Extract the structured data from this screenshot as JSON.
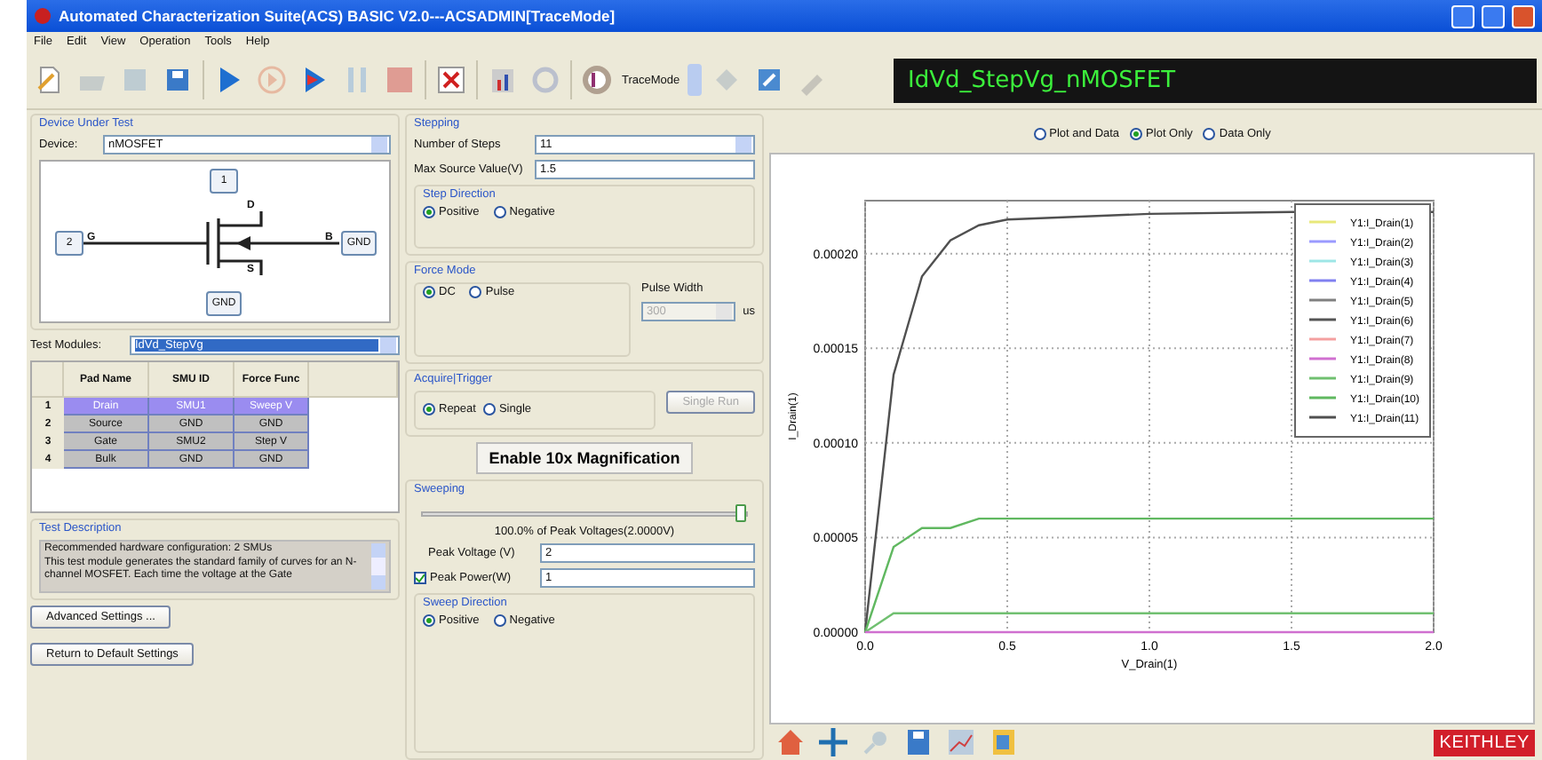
{
  "window": {
    "title": "Automated Characterization Suite(ACS) BASIC V2.0---ACSADMIN[TraceMode]"
  },
  "menu": [
    "File",
    "Edit",
    "View",
    "Operation",
    "Tools",
    "Help"
  ],
  "toolbar": {
    "mode_label": "TraceMode",
    "test_title": "IdVd_StepVg_nMOSFET"
  },
  "device_under_test": {
    "title": "Device Under Test",
    "device_label": "Device:",
    "device_value": "nMOSFET",
    "diagram": {
      "top_pad": "1",
      "left_pad": "2",
      "right_pad": "GND",
      "bottom_pad": "GND",
      "gate": "G",
      "drain": "D",
      "bulk": "B",
      "source": "S"
    }
  },
  "test_modules": {
    "label": "Test Modules:",
    "value": "IdVd_StepVg"
  },
  "pad_table": {
    "columns": [
      "Pad Name",
      "SMU  ID",
      "Force Func"
    ],
    "rows": [
      {
        "index": "1",
        "cells": [
          "Drain",
          "SMU1",
          "Sweep V"
        ],
        "selected": true
      },
      {
        "index": "2",
        "cells": [
          "Source",
          "GND",
          "GND"
        ],
        "selected": false
      },
      {
        "index": "3",
        "cells": [
          "Gate",
          "SMU2",
          "Step V"
        ],
        "selected": false
      },
      {
        "index": "4",
        "cells": [
          "Bulk",
          "GND",
          "GND"
        ],
        "selected": false
      }
    ]
  },
  "test_description": {
    "title": "Test Description",
    "lines": [
      "Recommended hardware configuration: 2 SMUs",
      "This test module generates the standard family of curves for an N-channel MOSFET. Each time the voltage at the Gate"
    ]
  },
  "left_buttons": [
    "Advanced Settings ...",
    "Return to Default Settings"
  ],
  "stepping": {
    "title": "Stepping",
    "steps_label": "Number  of  Steps",
    "steps_value": "11",
    "max_label": "Max Source Value(V)",
    "max_value": "1.5",
    "direction_title": "Step Direction",
    "direction": [
      {
        "label": "Positive",
        "selected": true
      },
      {
        "label": "Negative",
        "selected": false
      }
    ]
  },
  "force_mode": {
    "title": "Force Mode",
    "options": [
      {
        "label": "DC",
        "selected": true
      },
      {
        "label": "Pulse",
        "selected": false
      }
    ],
    "pulse_label": "Pulse Width",
    "pulse_value": "300",
    "pulse_disabled": true,
    "pulse_unit": "us"
  },
  "acquire": {
    "title": "Acquire|Trigger",
    "options": [
      {
        "label": "Repeat",
        "selected": true
      },
      {
        "label": "Single",
        "selected": false
      }
    ],
    "single_run": "Single Run",
    "single_run_disabled": true
  },
  "magnify_button": "Enable 10x Magnification",
  "sweeping": {
    "title": "Sweeping",
    "level": 1,
    "reading": "100.0% of Peak Voltages(2.0000V)",
    "peak_voltage_label": "Peak  Voltage (V)",
    "peak_voltage": "2",
    "peak_power_label": "Peak Power(W)",
    "peak_power_checked": true,
    "peak_power": "1",
    "direction_title": "Sweep Direction",
    "direction": [
      {
        "label": "Positive",
        "selected": true
      },
      {
        "label": "Negative",
        "selected": false
      }
    ]
  },
  "view_options": [
    {
      "label": "Plot and Data",
      "selected": false
    },
    {
      "label": "Plot Only",
      "selected": true
    },
    {
      "label": "Data Only",
      "selected": false
    }
  ],
  "chart": {
    "chart_data": {
      "type": "line",
      "xlabel": "V_Drain(1)",
      "ylabel": "I_Drain(1)",
      "x": [
        0,
        0.1,
        0.2,
        0.3,
        0.4,
        0.5,
        1.0,
        1.5,
        2.0
      ],
      "xlim": [
        0,
        2
      ],
      "ylim": [
        0,
        0.000228
      ],
      "grid": true,
      "legend": true,
      "xticks": [
        {
          "value": 0,
          "label": "0.0"
        },
        {
          "value": 0.5,
          "label": "0.5"
        },
        {
          "value": 1,
          "label": "1.0"
        },
        {
          "value": 1.5,
          "label": "1.5"
        },
        {
          "value": 2,
          "label": "2.0"
        }
      ],
      "yticks": [
        {
          "value": 0,
          "label": "0.00000"
        },
        {
          "value": 5e-05,
          "label": "0.00005"
        },
        {
          "value": 0.0001,
          "label": "0.00010"
        },
        {
          "value": 0.00015,
          "label": "0.00015"
        },
        {
          "value": 0.0002,
          "label": "0.00020"
        }
      ],
      "series": [
        {
          "name": "Y1:I_Drain(1)",
          "color": "#e8e87a",
          "values": [
            null,
            null,
            null,
            null,
            null,
            null,
            null,
            null,
            null
          ]
        },
        {
          "name": "Y1:I_Drain(2)",
          "color": "#9a9aff",
          "values": [
            null,
            null,
            null,
            null,
            null,
            null,
            null,
            null,
            null
          ]
        },
        {
          "name": "Y1:I_Drain(3)",
          "color": "#9ee6e6",
          "values": [
            null,
            null,
            null,
            null,
            null,
            null,
            null,
            null,
            null
          ]
        },
        {
          "name": "Y1:I_Drain(4)",
          "color": "#8080f0",
          "values": [
            null,
            null,
            null,
            null,
            null,
            null,
            null,
            null,
            null
          ]
        },
        {
          "name": "Y1:I_Drain(5)",
          "color": "#808080",
          "values": [
            null,
            null,
            null,
            null,
            null,
            null,
            null,
            null,
            null
          ]
        },
        {
          "name": "Y1:I_Drain(6)",
          "color": "#555555",
          "values": [
            null,
            null,
            null,
            null,
            null,
            null,
            null,
            null,
            null
          ]
        },
        {
          "name": "Y1:I_Drain(7)",
          "color": "#f4a0a0",
          "values": [
            null,
            null,
            null,
            null,
            null,
            null,
            null,
            null,
            null
          ]
        },
        {
          "name": "Y1:I_Drain(8)",
          "color": "#d070d0",
          "values": [
            0,
            0,
            0,
            0,
            0,
            0,
            0,
            0,
            0
          ]
        },
        {
          "name": "Y1:I_Drain(9)",
          "color": "#70c070",
          "values": [
            0,
            1e-05,
            1e-05,
            1e-05,
            1e-05,
            1e-05,
            1e-05,
            1e-05,
            1e-05
          ]
        },
        {
          "name": "Y1:I_Drain(10)",
          "color": "#60b860",
          "values": [
            0,
            4.5e-05,
            5.5e-05,
            5.5e-05,
            6e-05,
            6e-05,
            6e-05,
            6e-05,
            6e-05
          ]
        },
        {
          "name": "Y1:I_Drain(11)",
          "color": "#505050",
          "values": [
            0,
            0.000136,
            0.000188,
            0.000207,
            0.000215,
            0.000218,
            0.000221,
            0.000222,
            0.000222
          ]
        }
      ]
    }
  },
  "logo": "KEITHLEY"
}
